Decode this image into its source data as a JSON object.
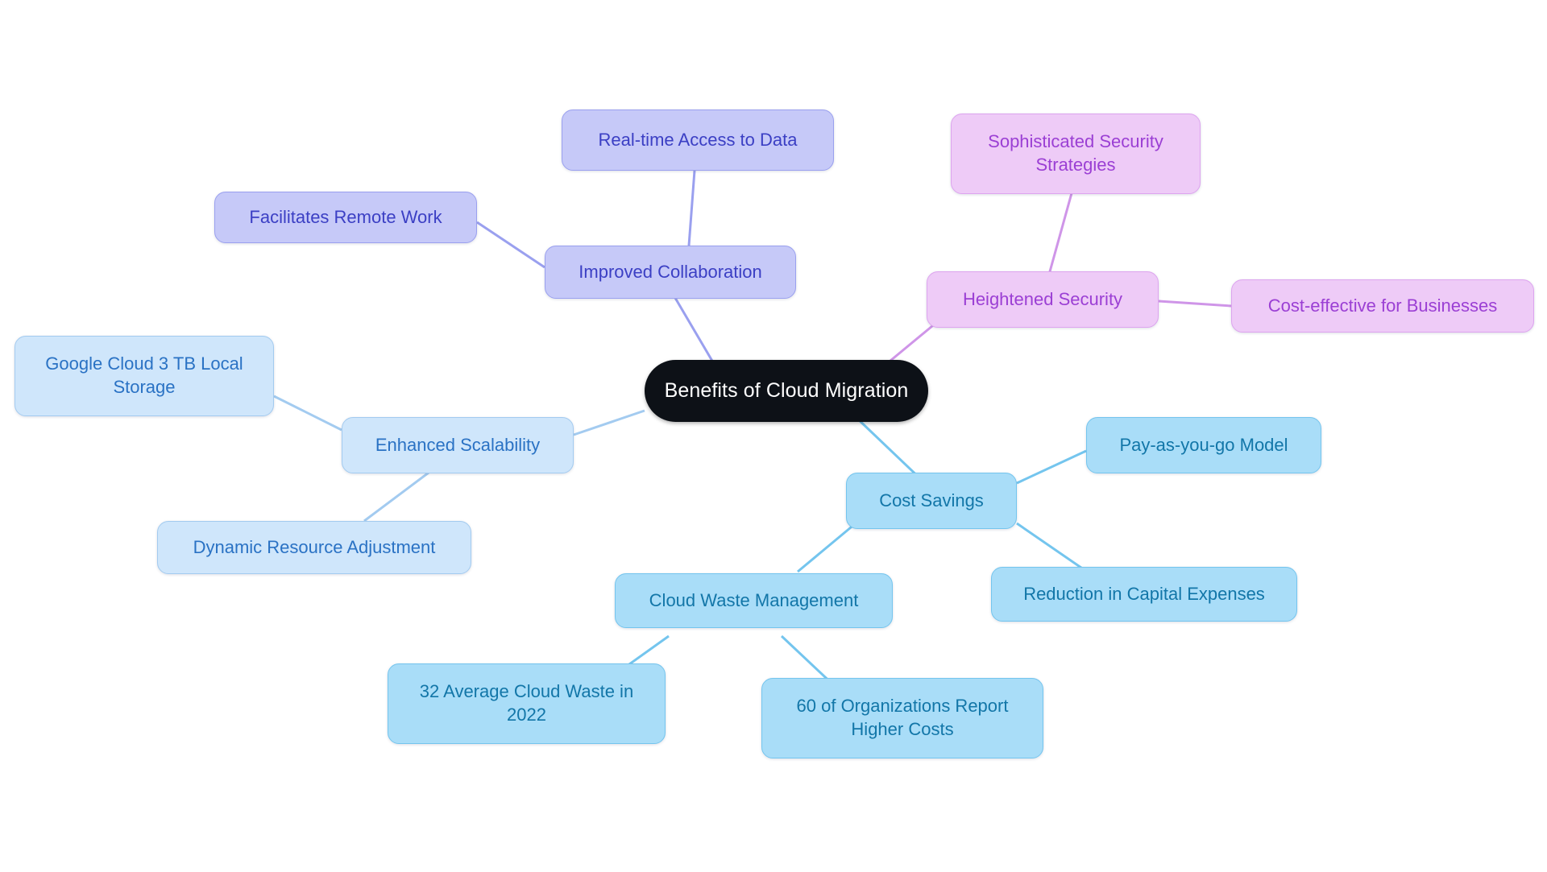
{
  "diagram": {
    "type": "mindmap",
    "title": "Benefits of Cloud Migration",
    "background": "#ffffff",
    "palette": {
      "root_fill": "#0d1117",
      "root_text": "#ffffff",
      "collaboration_fill": "#c6c9f8",
      "collaboration_stroke": "#9aa0ef",
      "collaboration_text": "#3b3fc4",
      "security_fill": "#eecbf7",
      "security_stroke": "#dda4ef",
      "security_text": "#9b3fd4",
      "scalability_fill": "#cfe6fb",
      "scalability_stroke": "#a3cbf0",
      "scalability_text": "#2a72c4",
      "cost_fill": "#a9ddf8",
      "cost_stroke": "#74c5ee",
      "cost_text": "#1276a8"
    }
  },
  "nodes": {
    "root": {
      "label": "Benefits of Cloud Migration"
    },
    "improved_collaboration": {
      "label": "Improved Collaboration"
    },
    "real_time_access": {
      "label": "Real-time Access to Data"
    },
    "facilitates_remote_work": {
      "label": "Facilitates Remote Work"
    },
    "heightened_security": {
      "label": "Heightened Security"
    },
    "sophisticated_security_strategies": {
      "label": "Sophisticated Security\nStrategies"
    },
    "cost_effective_for_businesses": {
      "label": "Cost-effective for Businesses"
    },
    "enhanced_scalability": {
      "label": "Enhanced Scalability"
    },
    "google_cloud_storage": {
      "label": "Google Cloud 3 TB Local\nStorage"
    },
    "dynamic_resource_adjustment": {
      "label": "Dynamic Resource Adjustment"
    },
    "cost_savings": {
      "label": "Cost Savings"
    },
    "pay_as_you_go": {
      "label": "Pay-as-you-go Model"
    },
    "reduction_capital_expenses": {
      "label": "Reduction in Capital Expenses"
    },
    "cloud_waste_management": {
      "label": "Cloud Waste Management"
    },
    "average_cloud_waste": {
      "label": "32 Average Cloud Waste in\n2022"
    },
    "organizations_higher_costs": {
      "label": "60 of Organizations Report\nHigher Costs"
    }
  },
  "hierarchy": [
    {
      "branch": "Improved Collaboration",
      "children": [
        "Real-time Access to Data",
        "Facilitates Remote Work"
      ]
    },
    {
      "branch": "Heightened Security",
      "children": [
        "Sophisticated Security Strategies",
        "Cost-effective for Businesses"
      ]
    },
    {
      "branch": "Enhanced Scalability",
      "children": [
        "Google Cloud 3 TB Local Storage",
        "Dynamic Resource Adjustment"
      ]
    },
    {
      "branch": "Cost Savings",
      "children": [
        "Pay-as-you-go Model",
        "Reduction in Capital Expenses",
        "Cloud Waste Management"
      ]
    },
    {
      "branch": "Cloud Waste Management",
      "children": [
        "32 Average Cloud Waste in 2022",
        "60 of Organizations Report Higher Costs"
      ]
    }
  ]
}
